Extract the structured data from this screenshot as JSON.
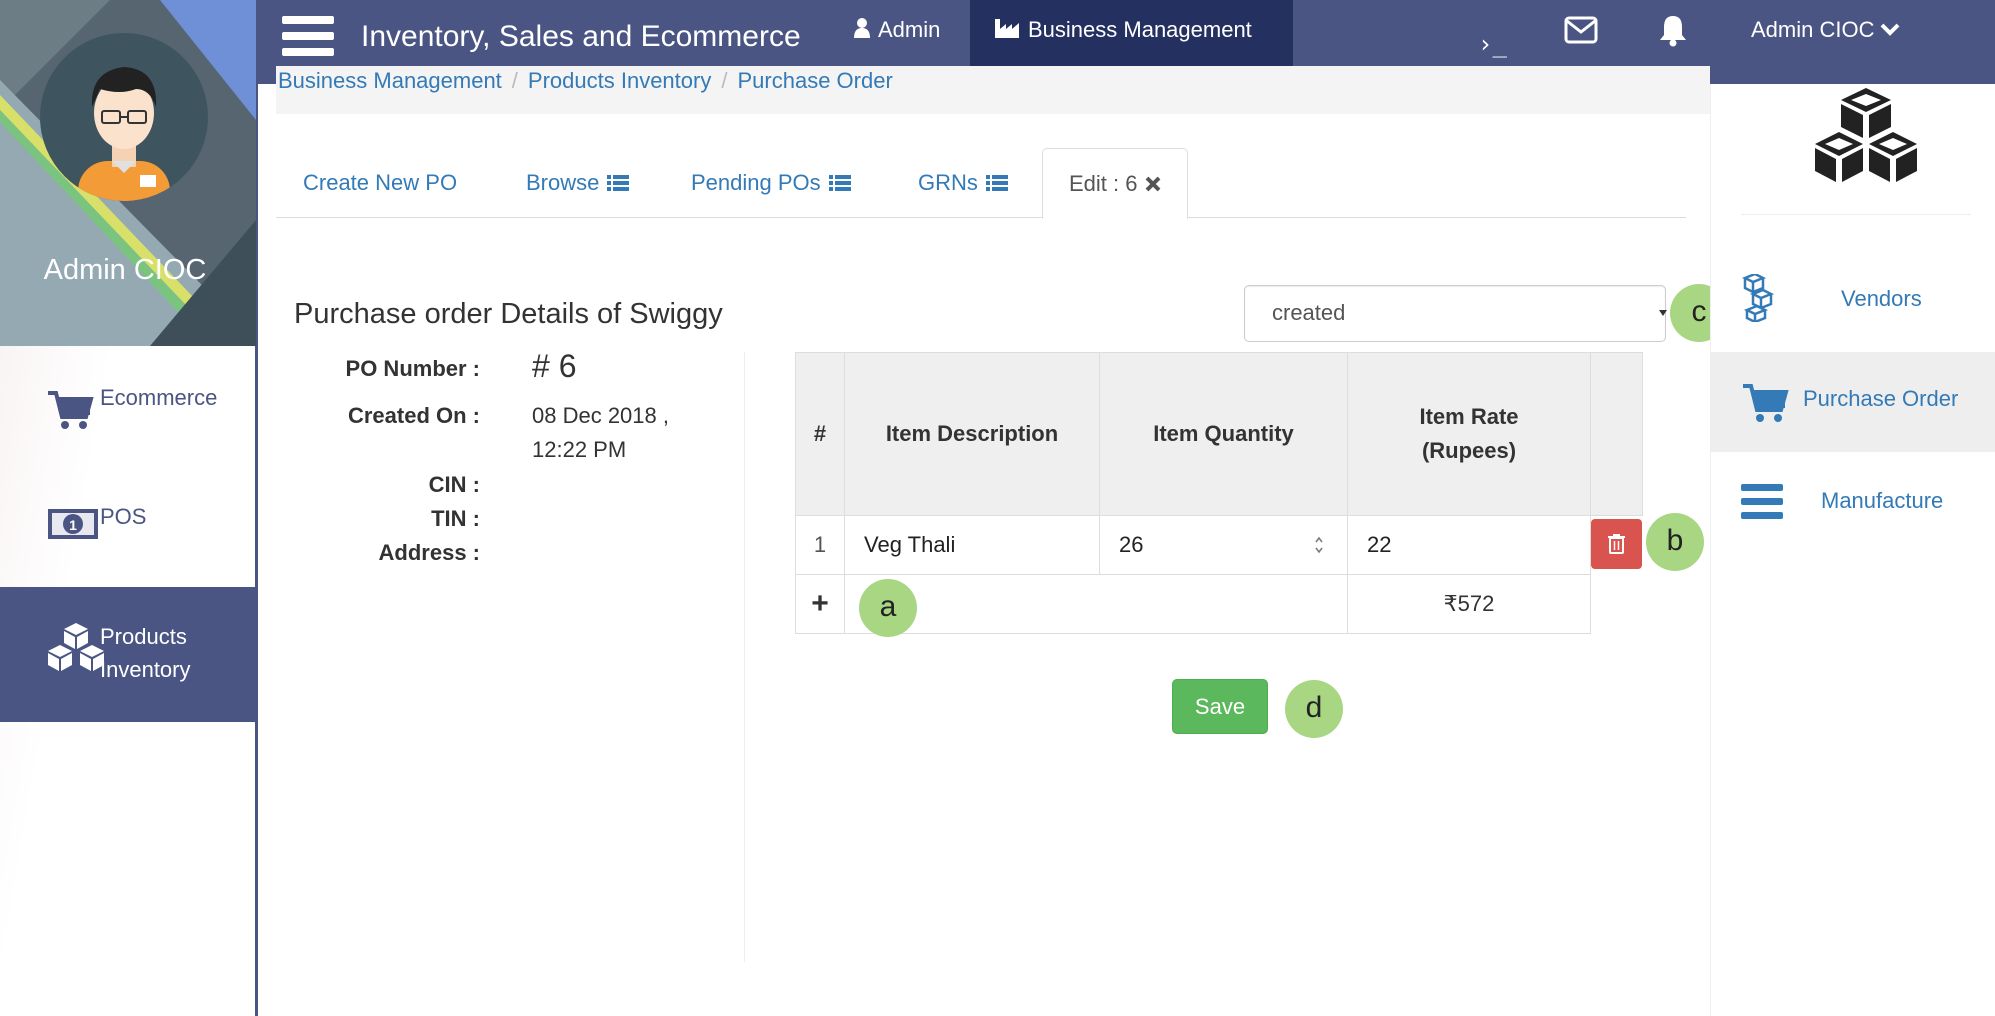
{
  "header": {
    "app_title": "Inventory, Sales and Ecommerce",
    "nav_admin": "Admin",
    "nav_business": "Business Management",
    "terminal_glyph": "›_",
    "user_menu": "Admin CIOC"
  },
  "sidebar": {
    "profile_name": "Admin CIOC",
    "items": [
      {
        "label": "Ecommerce",
        "icon": "cart-icon"
      },
      {
        "label": "POS",
        "icon": "money-icon"
      },
      {
        "label": "Products Inventory",
        "icon": "cubes-icon",
        "active": true
      }
    ]
  },
  "breadcrumb": [
    "Business Management",
    "Products Inventory",
    "Purchase Order"
  ],
  "tabs": [
    {
      "label": "Create New PO"
    },
    {
      "label": "Browse",
      "icon": "list-icon"
    },
    {
      "label": "Pending POs",
      "icon": "list-icon"
    },
    {
      "label": "GRNs",
      "icon": "list-icon"
    },
    {
      "label": "Edit : 6",
      "icon": "close-icon",
      "active": true
    }
  ],
  "po": {
    "title": "Purchase order Details of Swiggy",
    "status": "created",
    "fields": {
      "po_number_label": "PO Number :",
      "po_number": "# 6",
      "created_on_label": "Created On :",
      "created_on_line1": "08 Dec 2018 ,",
      "created_on_line2": "12:22 PM",
      "cin_label": "CIN :",
      "tin_label": "TIN :",
      "address_label": "Address :"
    }
  },
  "items_table": {
    "headers": [
      "#",
      "Item Description",
      "Item Quantity",
      "Item Rate",
      "(Rupees)"
    ],
    "rows": [
      {
        "index": "1",
        "description": "Veg Thali",
        "quantity": "26",
        "rate": "22"
      }
    ],
    "add_glyph": "+",
    "total": "₹572"
  },
  "save_label": "Save",
  "badges": {
    "a": "a",
    "b": "b",
    "c": "c",
    "d": "d"
  },
  "right_sidebar": {
    "items": [
      {
        "label": "Vendors",
        "icon": "vendors-icon"
      },
      {
        "label": "Purchase Order",
        "icon": "cart-icon",
        "active": true
      },
      {
        "label": "Manufacture",
        "icon": "bars-icon"
      }
    ]
  },
  "colors": {
    "primary_nav": "#4a5583",
    "active_nav": "#243160",
    "link": "#337ab7",
    "save_green": "#5cb85c",
    "delete_red": "#d9534f",
    "badge_green": "#a8d683"
  }
}
